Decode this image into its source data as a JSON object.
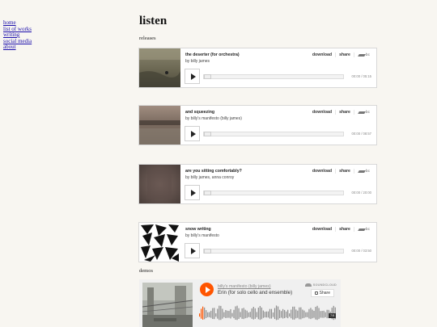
{
  "nav": {
    "items": [
      "home",
      "list of works",
      "writing",
      "social media",
      "about"
    ]
  },
  "page": {
    "title": "listen",
    "releases_label": "releases",
    "demos_label": "demos"
  },
  "player_labels": {
    "download": "download",
    "share": "share",
    "bc": "bc"
  },
  "releases": [
    {
      "title": "the deserter (for orchestra)",
      "artist": "by billy james",
      "time": "00:00 / 05:15",
      "progress": 0
    },
    {
      "title": "and squeezing",
      "artist": "by billy's manifesto (billy james)",
      "time": "00:00 / 08:57",
      "progress": 0
    },
    {
      "title": "are you sitting comfortably?",
      "artist": "by billy james, anna conroy",
      "time": "00:00 / 20:00",
      "progress": 0
    },
    {
      "title": "snow writing",
      "artist": "by billy's manifesto",
      "time": "00:00 / 03:50",
      "progress": 0
    }
  ],
  "soundcloud": {
    "artist": "billy's manifesto (billy james)",
    "track": "Erin (for solo cello and ensemble)",
    "logo": "SOUNDCLOUD",
    "share": "Share",
    "duration": "7:5"
  },
  "colors": {
    "background": "#f8f6f1",
    "link": "#1a0dab",
    "soundcloud_orange": "#ff5500"
  },
  "icons": {
    "play": "play-icon",
    "bandcamp": "bandcamp-logo-icon",
    "soundcloud": "soundcloud-logo-icon",
    "share": "share-icon"
  }
}
